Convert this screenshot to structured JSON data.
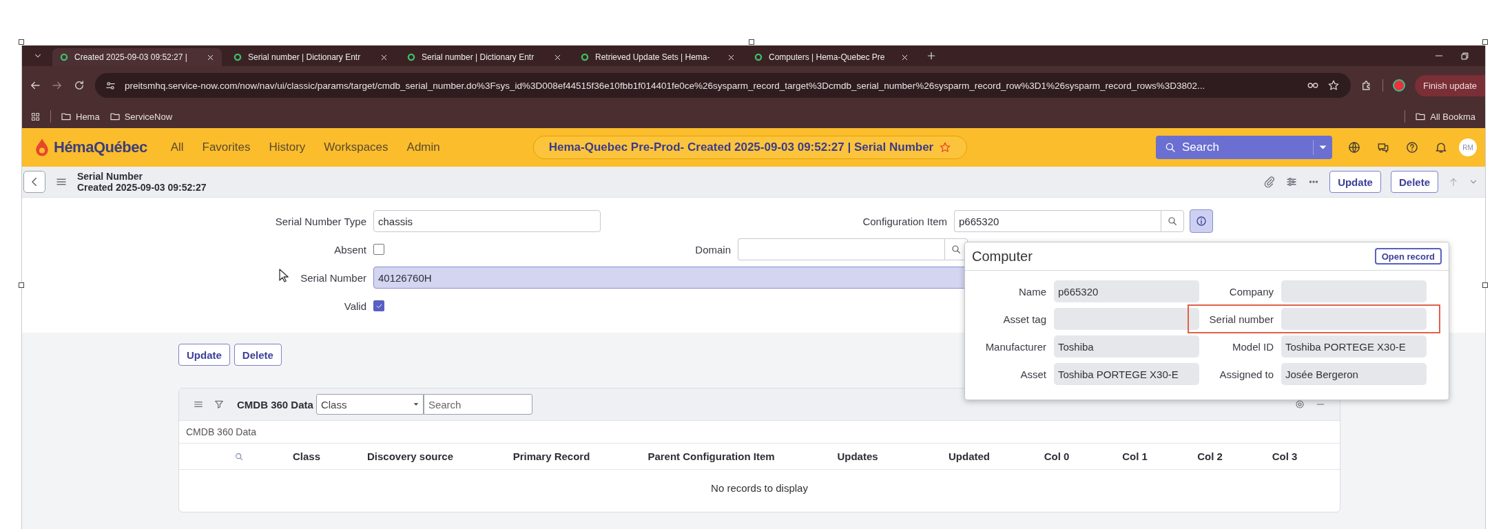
{
  "browser": {
    "tabs": [
      {
        "title": "Created 2025-09-03 09:52:27 |",
        "selected": true
      },
      {
        "title": "Serial number | Dictionary Entr",
        "selected": false
      },
      {
        "title": "Serial number | Dictionary Entr",
        "selected": false
      },
      {
        "title": "Retrieved Update Sets | Hema-",
        "selected": false
      },
      {
        "title": "Computers | Hema-Quebec Pre",
        "selected": false
      }
    ],
    "url": "preitsmhq.service-now.com/now/nav/ui/classic/params/target/cmdb_serial_number.do%3Fsys_id%3D008ef44515f36e10fbb1f014401fe0ce%26sysparm_record_target%3Dcmdb_serial_number%26sysparm_record_row%3D1%26sysparm_record_rows%3D3802...",
    "bookmarks": [
      "Hema",
      "ServiceNow"
    ],
    "all_bookmarks": "All Bookma",
    "finish_update": "Finish update"
  },
  "nav": {
    "logo": "HémaQuébec",
    "menu": [
      "All",
      "Favorites",
      "History",
      "Workspaces",
      "Admin"
    ],
    "context": "Hema-Quebec Pre-Prod- Created 2025-09-03 09:52:27 | Serial Number",
    "favorite": false,
    "search_placeholder": "Search",
    "avatar": "RM"
  },
  "record": {
    "title": "Serial Number",
    "subtitle": "Created 2025-09-03 09:52:27",
    "actions": [
      "Update",
      "Delete"
    ]
  },
  "form": {
    "rows": [
      {
        "left": {
          "kind": "text",
          "label": "Serial Number Type",
          "value": "chassis",
          "focused": false
        },
        "right": {
          "kind": "reference",
          "label": "Configuration Item",
          "value": "p665320"
        }
      },
      {
        "left": {
          "kind": "checkbox",
          "label": "Absent",
          "checked": false
        },
        "right": {
          "kind": "reference",
          "label": "Domain"
        }
      },
      {
        "left": {
          "kind": "text",
          "label": "Serial Number",
          "value": "40126760H",
          "focused": true
        }
      },
      {
        "left": {
          "kind": "checkbox",
          "label": "Valid",
          "checked": true
        }
      }
    ]
  },
  "buttons": [
    "Update",
    "Delete"
  ],
  "related_list": {
    "title": "CMDB 360 Data",
    "filter": "Class",
    "search_placeholder": "Search",
    "breadcrumb": "CMDB 360 Data",
    "columns": [
      "Class",
      "Discovery source",
      "Primary Record",
      "Parent Configuration Item",
      "Updates",
      "Updated",
      "Col 0",
      "Col 1",
      "Col 2",
      "Col 3"
    ],
    "empty": "No records to display"
  },
  "popup": {
    "title": "Computer",
    "open_button": "Open record",
    "fields": [
      {
        "label": "Name",
        "value": "p665320",
        "highlighted": false
      },
      {
        "label": "Company",
        "highlighted": false
      },
      {
        "label": "Asset tag",
        "highlighted": false
      },
      {
        "label": "Serial number",
        "highlighted": true
      },
      {
        "label": "Manufacturer",
        "value": "Toshiba",
        "highlighted": false
      },
      {
        "label": "Model ID",
        "value": "Toshiba PORTEGE X30-E",
        "highlighted": false
      },
      {
        "label": "Asset",
        "value": "Toshiba PORTEGE X30-E",
        "highlighted": false
      },
      {
        "label": "Assigned to",
        "value": "Josée Bergeron",
        "highlighted": false
      }
    ]
  }
}
